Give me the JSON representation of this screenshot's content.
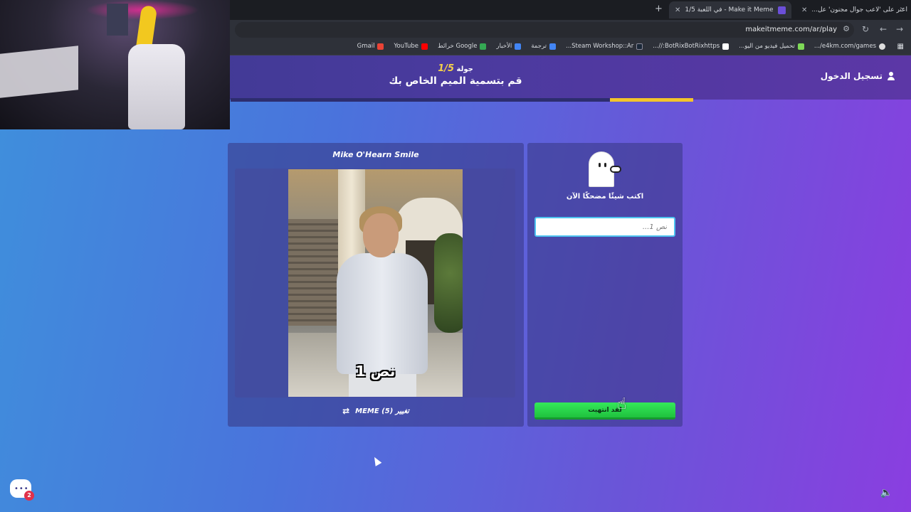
{
  "browser": {
    "tabs": [
      {
        "label": "اعثر على 'لاعب جوال مجنون' عل...",
        "active": false,
        "favicon_color": "#111111"
      },
      {
        "label": "Make it Meme - في اللعبة 1/5",
        "active": true,
        "favicon_color": "#6b4fd8"
      }
    ],
    "url": "makeitmeme.com/ar/play",
    "bookmarks": [
      {
        "label": "Gmail",
        "color": "#ea4335"
      },
      {
        "label": "YouTube",
        "color": "#ff0000"
      },
      {
        "label": "Google خرائط",
        "color": "#34a853"
      },
      {
        "label": "الأخبار",
        "color": "#4285f4"
      },
      {
        "label": "ترجمة",
        "color": "#4285f4"
      },
      {
        "label": "Steam Workshop::Ar...",
        "color": "#1b2838"
      },
      {
        "label": "BotRixBotRixhttps://...",
        "color": "#ffffff"
      },
      {
        "label": "تحميل فيديو من اليو...",
        "color": "#7ed957"
      },
      {
        "label": "e4km.com/games/...",
        "color": "#dddddd"
      }
    ]
  },
  "game": {
    "round_word": "جولة",
    "round_value": "1/5",
    "title": "قم بتسمية الميم الخاص بك",
    "login_label": "تسجيل الدخول",
    "progress_fraction": 0.18,
    "meme_name": "Mike O'Hearn Smile",
    "meme_caption": "نص 1",
    "change_button_label": "تغيير MEME (5)",
    "prompt": "اكتب شيئًا مضحكًا الآن",
    "input_placeholder": "نص 1...",
    "input_value": "",
    "done_button_label": "لقد انتهيت",
    "chat_badge_count": "2"
  },
  "colors": {
    "accent_yellow": "#f3c52b",
    "done_green": "#2ed650",
    "input_border": "#4ec3f0"
  }
}
